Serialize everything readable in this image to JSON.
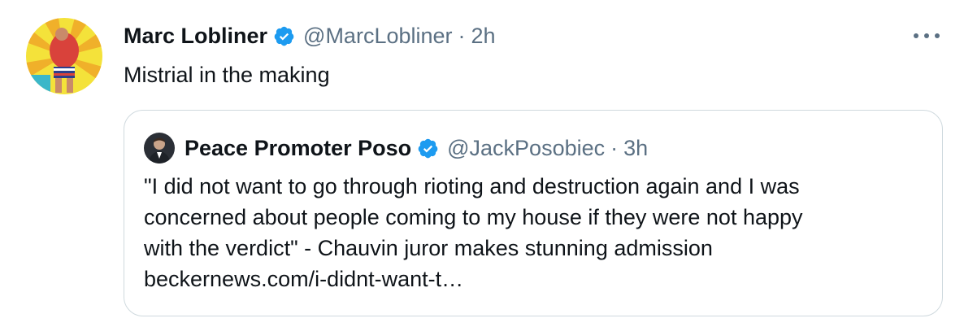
{
  "tweet": {
    "author_name": "Marc Lobliner",
    "author_handle": "@MarcLobliner",
    "separator": "·",
    "time": "2h",
    "text": "Mistrial in the making",
    "avatar_icon": "profile-photo",
    "more_icon": "more-horizontal-icon",
    "verified_icon": "verified-badge-icon"
  },
  "quoted": {
    "author_name": "Peace Promoter Poso",
    "author_handle": "@JackPosobiec",
    "separator": "·",
    "time": "3h",
    "text_lines": [
      "\"I did not want to go through rioting and destruction again and I was",
      "concerned about people coming to my house if they were not happy",
      "with the verdict\" - Chauvin juror makes stunning admission",
      "beckernews.com/i-didnt-want-t…"
    ]
  },
  "colors": {
    "text_primary": "#0f1419",
    "text_secondary": "#5b7083",
    "verified_blue": "#1d9bf0",
    "border": "#cfd9de"
  }
}
